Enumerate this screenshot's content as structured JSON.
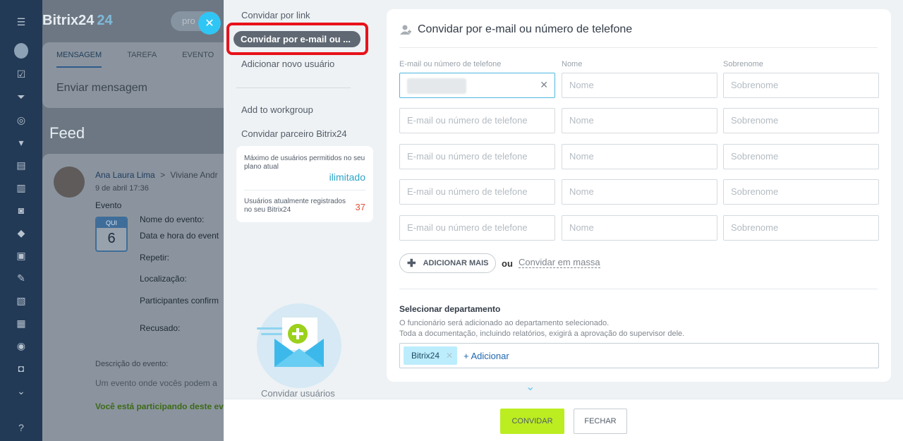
{
  "portal": {
    "brand": "Bitrix24",
    "brand_number": "24",
    "header_search": "pro",
    "composer_tabs": [
      "MENSAGEM",
      "TAREFA",
      "EVENTO"
    ],
    "composer_placeholder": "Enviar mensagem",
    "feed_title": "Feed",
    "post": {
      "author": "Ana Laura Lima",
      "recipient": "Viviane Andr",
      "date": "9 de abril 17:36",
      "type": "Evento",
      "calendar_weekday": "QUI",
      "calendar_day": "6",
      "fields": [
        "Nome do evento:",
        "Data e hora do event",
        "Repetir:",
        "Localização:",
        "Participantes confirm",
        "Recusado:"
      ],
      "description_label": "Descrição do evento:",
      "description": "Um evento onde vocês podem a",
      "participation": "Você está participando deste eve"
    }
  },
  "menu": {
    "invite_by_link": "Convidar por link",
    "invite_by_email": "Convidar por e-mail ou ...",
    "add_new_user": "Adicionar novo usuário",
    "add_to_workgroup": "Add to workgroup",
    "invite_partner": "Convidar parceiro Bitrix24",
    "limits": {
      "max_label": "Máximo de usuários permitidos no seu plano atual",
      "max_value": "ilimitado",
      "current_label": "Usuários atualmente registrados no seu Bitrix24",
      "current_value": "37"
    },
    "illustration_caption": "Convidar usuários"
  },
  "form": {
    "title": "Convidar por e-mail ou número de telefone",
    "col_email": "E-mail ou número de telefone",
    "col_name": "Nome",
    "col_surname": "Sobrenome",
    "email_placeholder": "E-mail ou número de telefone",
    "name_placeholder": "Nome",
    "surname_placeholder": "Sobrenome",
    "add_more": "ADICIONAR MAIS",
    "or": "ou",
    "bulk_invite": "Convidar em massa",
    "dept_title": "Selecionar departamento",
    "dept_desc_1": "O funcionário será adicionado ao departamento selecionado.",
    "dept_desc_2": "Toda a documentação, incluindo relatórios, exigirá a aprovação do supervisor dele.",
    "dept_tag": "Bitrix24",
    "dept_add": "+ Adicionar"
  },
  "footer": {
    "invite": "CONVIDAR",
    "close": "FECHAR"
  },
  "colors": {
    "accent": "#2fc6f6",
    "invite_button": "#bbed21",
    "highlight": "#e8121b"
  }
}
